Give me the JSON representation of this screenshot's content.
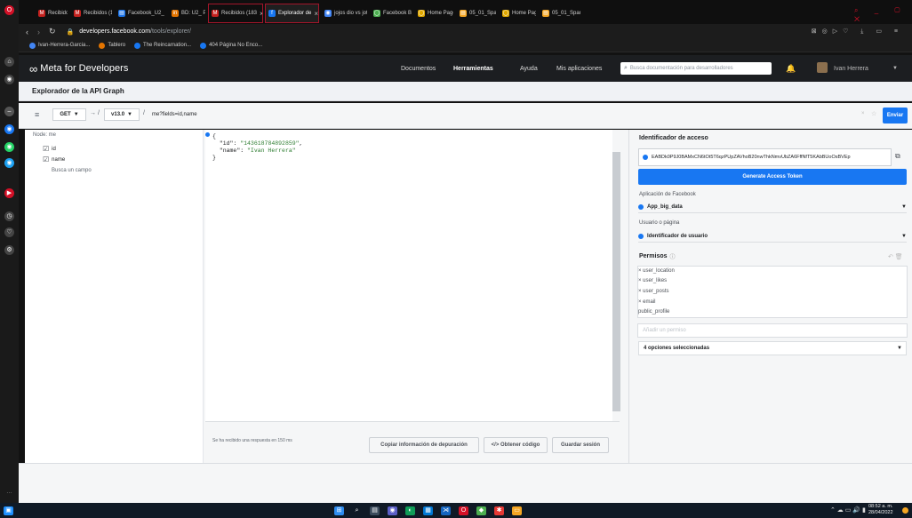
{
  "browser": {
    "tabs": [
      {
        "label": "Recibidos (214",
        "fav": "M",
        "color": "#c5221f"
      },
      {
        "label": "Recibidos (1.50",
        "fav": "M",
        "color": "#c5221f"
      },
      {
        "label": "Facebook_U2_",
        "fav": "▤",
        "color": "#1a73e8"
      },
      {
        "label": "BD: U2_ Proces",
        "fav": "in",
        "color": "#e37400"
      },
      {
        "label": "Recibidos (183",
        "fav": "M",
        "color": "#c5221f"
      },
      {
        "label": "Explorador de",
        "fav": "f",
        "color": "#1877f2"
      },
      {
        "label": "jojos dio vs jota",
        "fav": "◉",
        "color": "#4285f4"
      },
      {
        "label": "Facebook Busi",
        "fav": "◯",
        "color": "#4caf50"
      },
      {
        "label": "Home Page - S",
        "fav": "◯",
        "color": "#e0a800"
      },
      {
        "label": "05_01_Spark - J",
        "fav": "▤",
        "color": "#f5a623"
      },
      {
        "label": "Home Page - S",
        "fav": "◯",
        "color": "#e0a800"
      },
      {
        "label": "05_01_Spark - J",
        "fav": "▤",
        "color": "#f5a623"
      }
    ],
    "url_domain": "developers.facebook.com",
    "url_path": "/tools/explorer/",
    "bookmarks": [
      "Ivan-Herrera-Garcia...",
      "Tablero",
      "The Reincarnation...",
      "404 Página No Enco..."
    ]
  },
  "meta": {
    "logo": "Meta for Developers",
    "nav": [
      "Documentos",
      "Herramientas",
      "Ayuda",
      "Mis aplicaciones"
    ],
    "search_placeholder": "Busca documentación para desarrolladores",
    "user": "Ivan Herrera"
  },
  "explorer": {
    "title": "Explorador de la API Graph",
    "method": "GET",
    "version": "v13.0",
    "slash": "/",
    "query": "me?fields=id,name",
    "submit": "Enviar",
    "node_label": "Node: me",
    "fields": [
      "id",
      "name"
    ],
    "field_search": "Busca un campo",
    "response_id_key": "\"id\"",
    "response_id_val": "\"143618784892859\"",
    "response_name_key": "\"name\"",
    "response_name_val": "\"Ivan Herrera\"",
    "response_time": "Se ha recibido una respuesta en 150 ms",
    "btn_debug": "Copiar información de depuración",
    "btn_code": "</> Obtener código",
    "btn_save": "Guardar sesión"
  },
  "access": {
    "title": "Identificador de acceso",
    "token": "EABDk0P9J0BAMxCN6tOt5T6qzPUpZAVhoB20nwThkNmvUbZA6FffNfT5KAbBUoOsBVEp",
    "generate": "Generate Access Token",
    "app_label": "Aplicación de Facebook",
    "app_value": "App_big_data",
    "user_label": "Usuario o página",
    "user_value": "Identificador de usuario",
    "perm_title": "Permisos",
    "permissions": [
      "× user_location",
      "× user_likes",
      "× user_posts",
      "× email",
      "public_profile"
    ],
    "add_perm": "Añadir un permiso",
    "perm_selected": "4 opciones seleccionadas"
  },
  "taskbar": {
    "time": "08:52 a. m.",
    "date": "28/04/2022"
  }
}
